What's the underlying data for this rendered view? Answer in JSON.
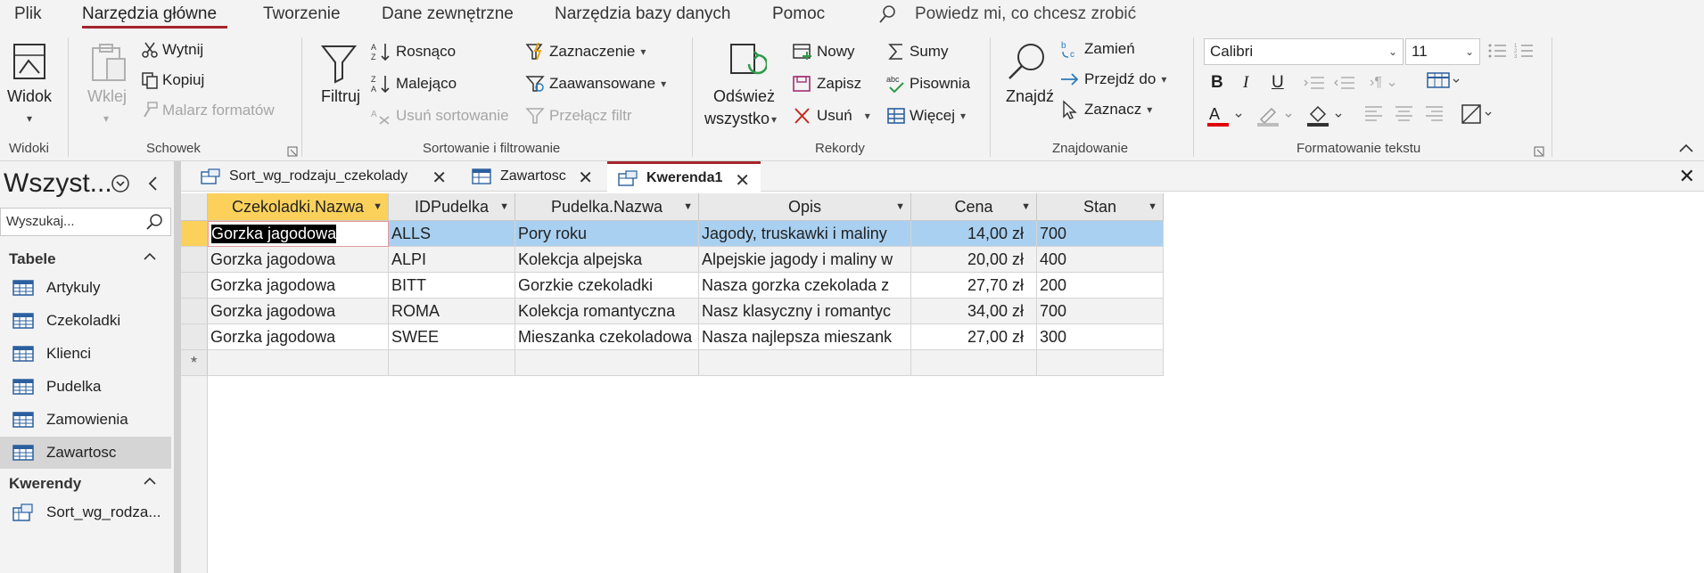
{
  "menu": {
    "tabs": [
      "Plik",
      "Narzędzia główne",
      "Tworzenie",
      "Dane zewnętrzne",
      "Narzędzia bazy danych",
      "Pomoc"
    ],
    "tell_me": "Powiedz mi, co chcesz zrobić"
  },
  "ribbon": {
    "views": {
      "view_label": "Widok",
      "group": "Widoki"
    },
    "clipboard": {
      "paste": "Wklej",
      "cut": "Wytnij",
      "copy": "Kopiuj",
      "format_painter": "Malarz formatów",
      "group": "Schowek"
    },
    "sort_filter": {
      "filter": "Filtruj",
      "ascending": "Rosnąco",
      "descending": "Malejąco",
      "remove_sort": "Usuń sortowanie",
      "selection": "Zaznaczenie",
      "advanced": "Zaawansowane",
      "toggle_filter": "Przełącz filtr",
      "group": "Sortowanie i filtrowanie"
    },
    "records": {
      "refresh_line1": "Odśwież",
      "refresh_line2": "wszystko",
      "new": "Nowy",
      "save": "Zapisz",
      "delete": "Usuń",
      "totals": "Sumy",
      "spelling": "Pisownia",
      "more": "Więcej",
      "group": "Rekordy"
    },
    "find": {
      "find": "Znajdź",
      "replace": "Zamień",
      "goto": "Przejdź do",
      "select": "Zaznacz",
      "group": "Znajdowanie"
    },
    "text_format": {
      "font": "Calibri",
      "size": "11",
      "bold": "B",
      "italic": "I",
      "underline": "U",
      "group": "Formatowanie tekstu"
    }
  },
  "nav": {
    "title": "Wszyst...",
    "search_placeholder": "Wyszukaj...",
    "tables_label": "Tabele",
    "tables": [
      "Artykuly",
      "Czekoladki",
      "Klienci",
      "Pudelka",
      "Zamowienia",
      "Zawartosc"
    ],
    "queries_label": "Kwerendy",
    "queries": [
      "Sort_wg_rodza..."
    ]
  },
  "doc_tabs": [
    "Sort_wg_rodzaju_czekolady",
    "Zawartosc",
    "Kwerenda1"
  ],
  "table": {
    "columns": [
      "Czekoladki.Nazwa",
      "IDPudelka",
      "Pudelka.Nazwa",
      "Opis",
      "Cena",
      "Stan"
    ],
    "rows": [
      [
        "Gorzka jagodowa",
        "ALLS",
        "Pory roku",
        "Jagody, truskawki i maliny",
        "14,00 zł",
        "700"
      ],
      [
        "Gorzka jagodowa",
        "ALPI",
        "Kolekcja alpejska",
        "Alpejskie jagody i maliny w",
        "20,00 zł",
        "400"
      ],
      [
        "Gorzka jagodowa",
        "BITT",
        "Gorzkie czekoladki",
        "Nasza gorzka czekolada z",
        "27,70 zł",
        "200"
      ],
      [
        "Gorzka jagodowa",
        "ROMA",
        "Kolekcja romantyczna",
        "Nasz klasyczny i romantyc",
        "34,00 zł",
        "700"
      ],
      [
        "Gorzka jagodowa",
        "SWEE",
        "Mieszanka czekoladowa",
        "Nasza najlepsza mieszank",
        "27,00 zł",
        "300"
      ]
    ],
    "new_row_marker": "*"
  },
  "colors": {
    "accent": "#a4262c",
    "selected_header": "#fbd15b",
    "selected_row": "#a9d0f0"
  }
}
